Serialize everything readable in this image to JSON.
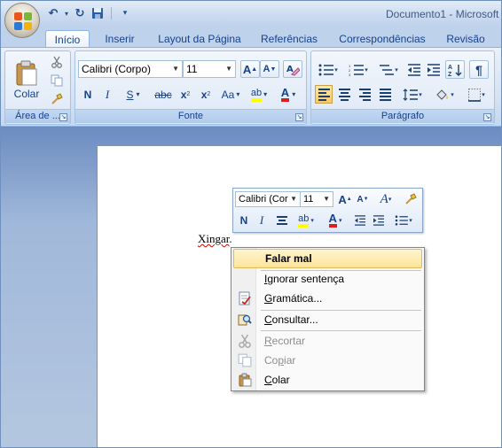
{
  "window": {
    "title": "Documento1 - Microsoft",
    "quick_access": {
      "undo": "↶",
      "redo": "↻",
      "save": "💾",
      "customize": "▾"
    }
  },
  "tabs": [
    {
      "label": "Início"
    },
    {
      "label": "Inserir"
    },
    {
      "label": "Layout da Página"
    },
    {
      "label": "Referências"
    },
    {
      "label": "Correspondências"
    },
    {
      "label": "Revisão"
    }
  ],
  "ribbon": {
    "clipboard": {
      "group_label": "Área de ...",
      "paste_label": "Colar"
    },
    "font": {
      "group_label": "Fonte",
      "font_name": "Calibri (Corpo)",
      "font_size": "11",
      "grow": "A",
      "shrink": "A",
      "bold": "N",
      "italic": "I",
      "underline": "S",
      "strike": "abc",
      "subscript": "x",
      "superscript": "x",
      "change_case": "Aa",
      "highlight": "ab",
      "font_color": "A"
    },
    "paragraph": {
      "group_label": "Parágrafo"
    }
  },
  "document": {
    "text": "Xingar",
    "after": "."
  },
  "mini_toolbar": {
    "font_name": "Calibri (Cor",
    "font_size": "11",
    "bold": "N",
    "italic": "I",
    "highlight": "ab",
    "font_color": "A"
  },
  "context_menu": {
    "items": [
      {
        "label": "Falar mal",
        "enabled": true,
        "highlighted": true
      },
      {
        "label": "Ignorar sentença",
        "accel": "I",
        "enabled": true
      },
      {
        "label": "Gramática...",
        "accel": "G",
        "enabled": true
      },
      {
        "label": "Consultar...",
        "accel": "C",
        "enabled": true
      },
      {
        "label": "Recortar",
        "accel": "R",
        "enabled": false
      },
      {
        "label": "Copiar",
        "accel": "C",
        "enabled": false
      },
      {
        "label": "Colar",
        "accel": "C",
        "enabled": true
      }
    ]
  },
  "colors": {
    "ribbon_text": "#15428b",
    "highlight_yellow": "#ffff00",
    "font_red": "#e31b1b",
    "menu_highlight": "#fde59a"
  }
}
